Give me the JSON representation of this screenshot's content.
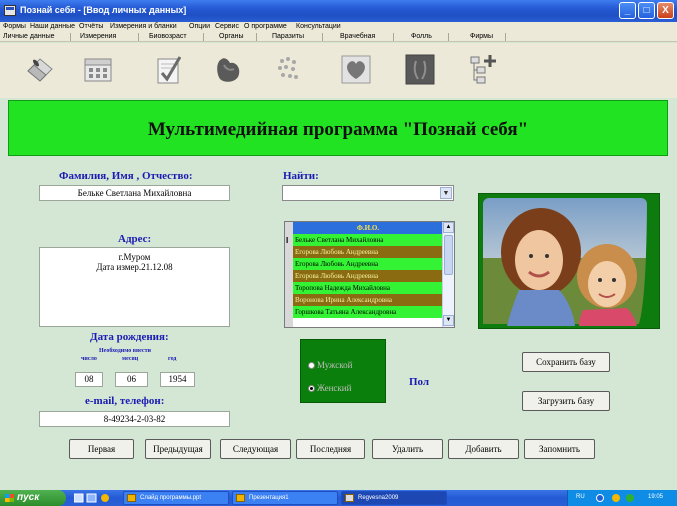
{
  "window": {
    "title": "Познай себя - [Ввод личных данных]",
    "controls": [
      "_",
      "□",
      "X"
    ]
  },
  "menu": [
    "Формы",
    "Наши данные",
    "Отчёты",
    "Измерения и бланки",
    "Опции",
    "Сервис",
    "О программе",
    "Консультации"
  ],
  "submenu": [
    "Личные данные",
    "Измерения",
    "Биовозраст",
    "Органы",
    "Паразиты",
    "Врачебная",
    "Фолль",
    "Фирмы"
  ],
  "toolbar_icons": [
    "eraser-icon",
    "calendar-icon",
    "checklist-icon",
    "organ-icon",
    "parasite-icon",
    "heart-icon",
    "xray-icon",
    "tree-icon"
  ],
  "banner": {
    "title": "Мультимедийная программа \"Познай себя\""
  },
  "person": {
    "name_label": "Фамилия,  Имя , Отчество:",
    "name_value": "Бельке Светлана Михайловна",
    "address_label": "Адрес:",
    "address_line1": "г.Муром",
    "address_line2": "Дата измер.21.12.08",
    "dob_label": "Дата рождения:",
    "dob_hint": "Необходимо ввести",
    "dob_day_label": "число",
    "dob_month_label": "месяц",
    "dob_year_label": "год",
    "dob_day": "08",
    "dob_month": "06",
    "dob_year": "1954",
    "contact_label": "e-mail, телефон:",
    "contact_value": "8-49234-2-03-82"
  },
  "search": {
    "label": "Найти:",
    "value": ""
  },
  "list": {
    "header": "Ф.И.О.",
    "marker": "I",
    "rows": [
      "Бельке Светлана Михайловна",
      "Егорова Любовь Андреевна",
      "Егорова Любовь Андреевна",
      "Егорова Любовь Андреевна",
      "Торопова Надежда Михайловна",
      "Воронова Ирина Александровна",
      "Горшкова Татьяна Александровна"
    ]
  },
  "gender": {
    "label": "Пол",
    "male": "Мужской",
    "female": "Женский",
    "selected": "Женский"
  },
  "side_buttons": {
    "save": "Сохранить базу",
    "load": "Загрузить базу"
  },
  "nav_buttons": {
    "first": "Первая",
    "prev": "Предыдущая",
    "next": "Следующая",
    "last": "Последняя",
    "delete": "Удалить",
    "add": "Добавить",
    "remember": "Запомнить"
  },
  "taskbar": {
    "start": "пуск",
    "tasks": [
      "Слайд программы.ppt",
      "Презентация1",
      "Regvesna2009"
    ],
    "lang": "RU",
    "clock": "19:05"
  },
  "colors": {
    "banner": "#22e322",
    "label": "#1a1ab4",
    "panel_green": "#0b7f0b",
    "background": "#d4e7d4"
  }
}
